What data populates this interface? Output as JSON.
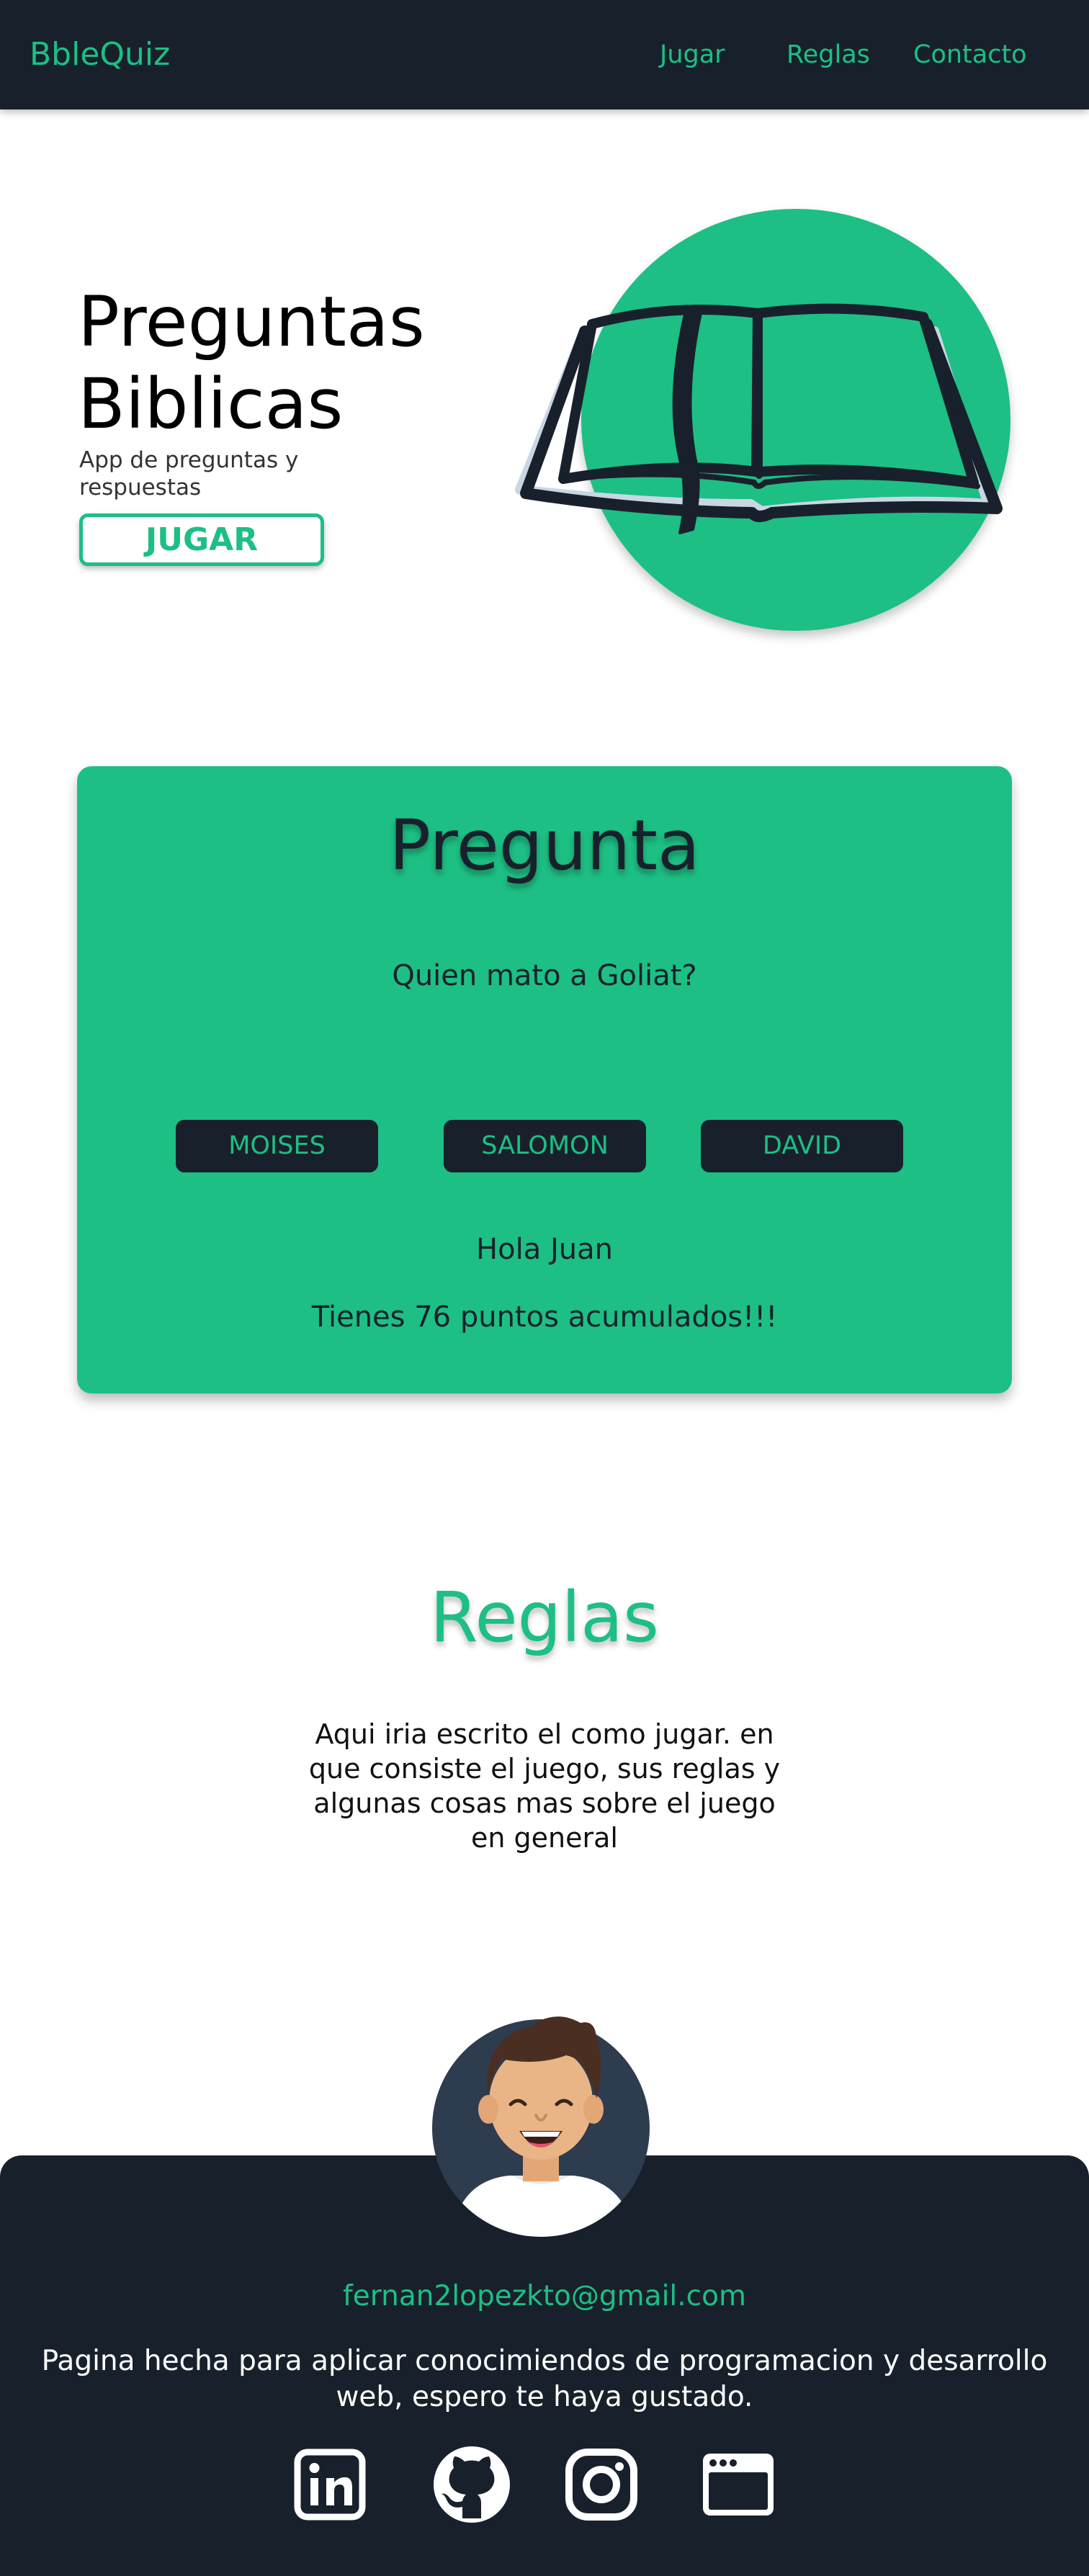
{
  "nav": {
    "brand": "BbleQuiz",
    "links": [
      "Jugar",
      "Reglas",
      "Contacto"
    ]
  },
  "hero": {
    "title_line1": "Preguntas",
    "title_line2": "Biblicas",
    "subtitle": "App de preguntas y respuestas",
    "button_label": "JUGAR",
    "image_icon": "open-bible-icon"
  },
  "quiz": {
    "title": "Pregunta",
    "question": "Quien mato a Goliat?",
    "answers": [
      "MOISES",
      "SALOMON",
      "DAVID"
    ],
    "greeting": "Hola Juan",
    "score_text": "Tienes 76 puntos acumulados!!!"
  },
  "rules": {
    "title": "Reglas",
    "text": "Aqui iria escrito el como jugar. en que consiste el juego, sus reglas y algunas cosas mas sobre el juego en general"
  },
  "footer": {
    "avatar_icon": "person-avatar-icon",
    "email": "fernan2lopezkto@gmail.com",
    "credits": "Pagina hecha para aplicar conocimiendos de programacion y desarrollo web, espero te haya gustado.",
    "social_icons": [
      "linkedin-icon",
      "github-icon",
      "instagram-icon",
      "browser-window-icon"
    ]
  },
  "colors": {
    "accent": "#1dbf84",
    "dark": "#18212b",
    "background": "#ffffff"
  }
}
